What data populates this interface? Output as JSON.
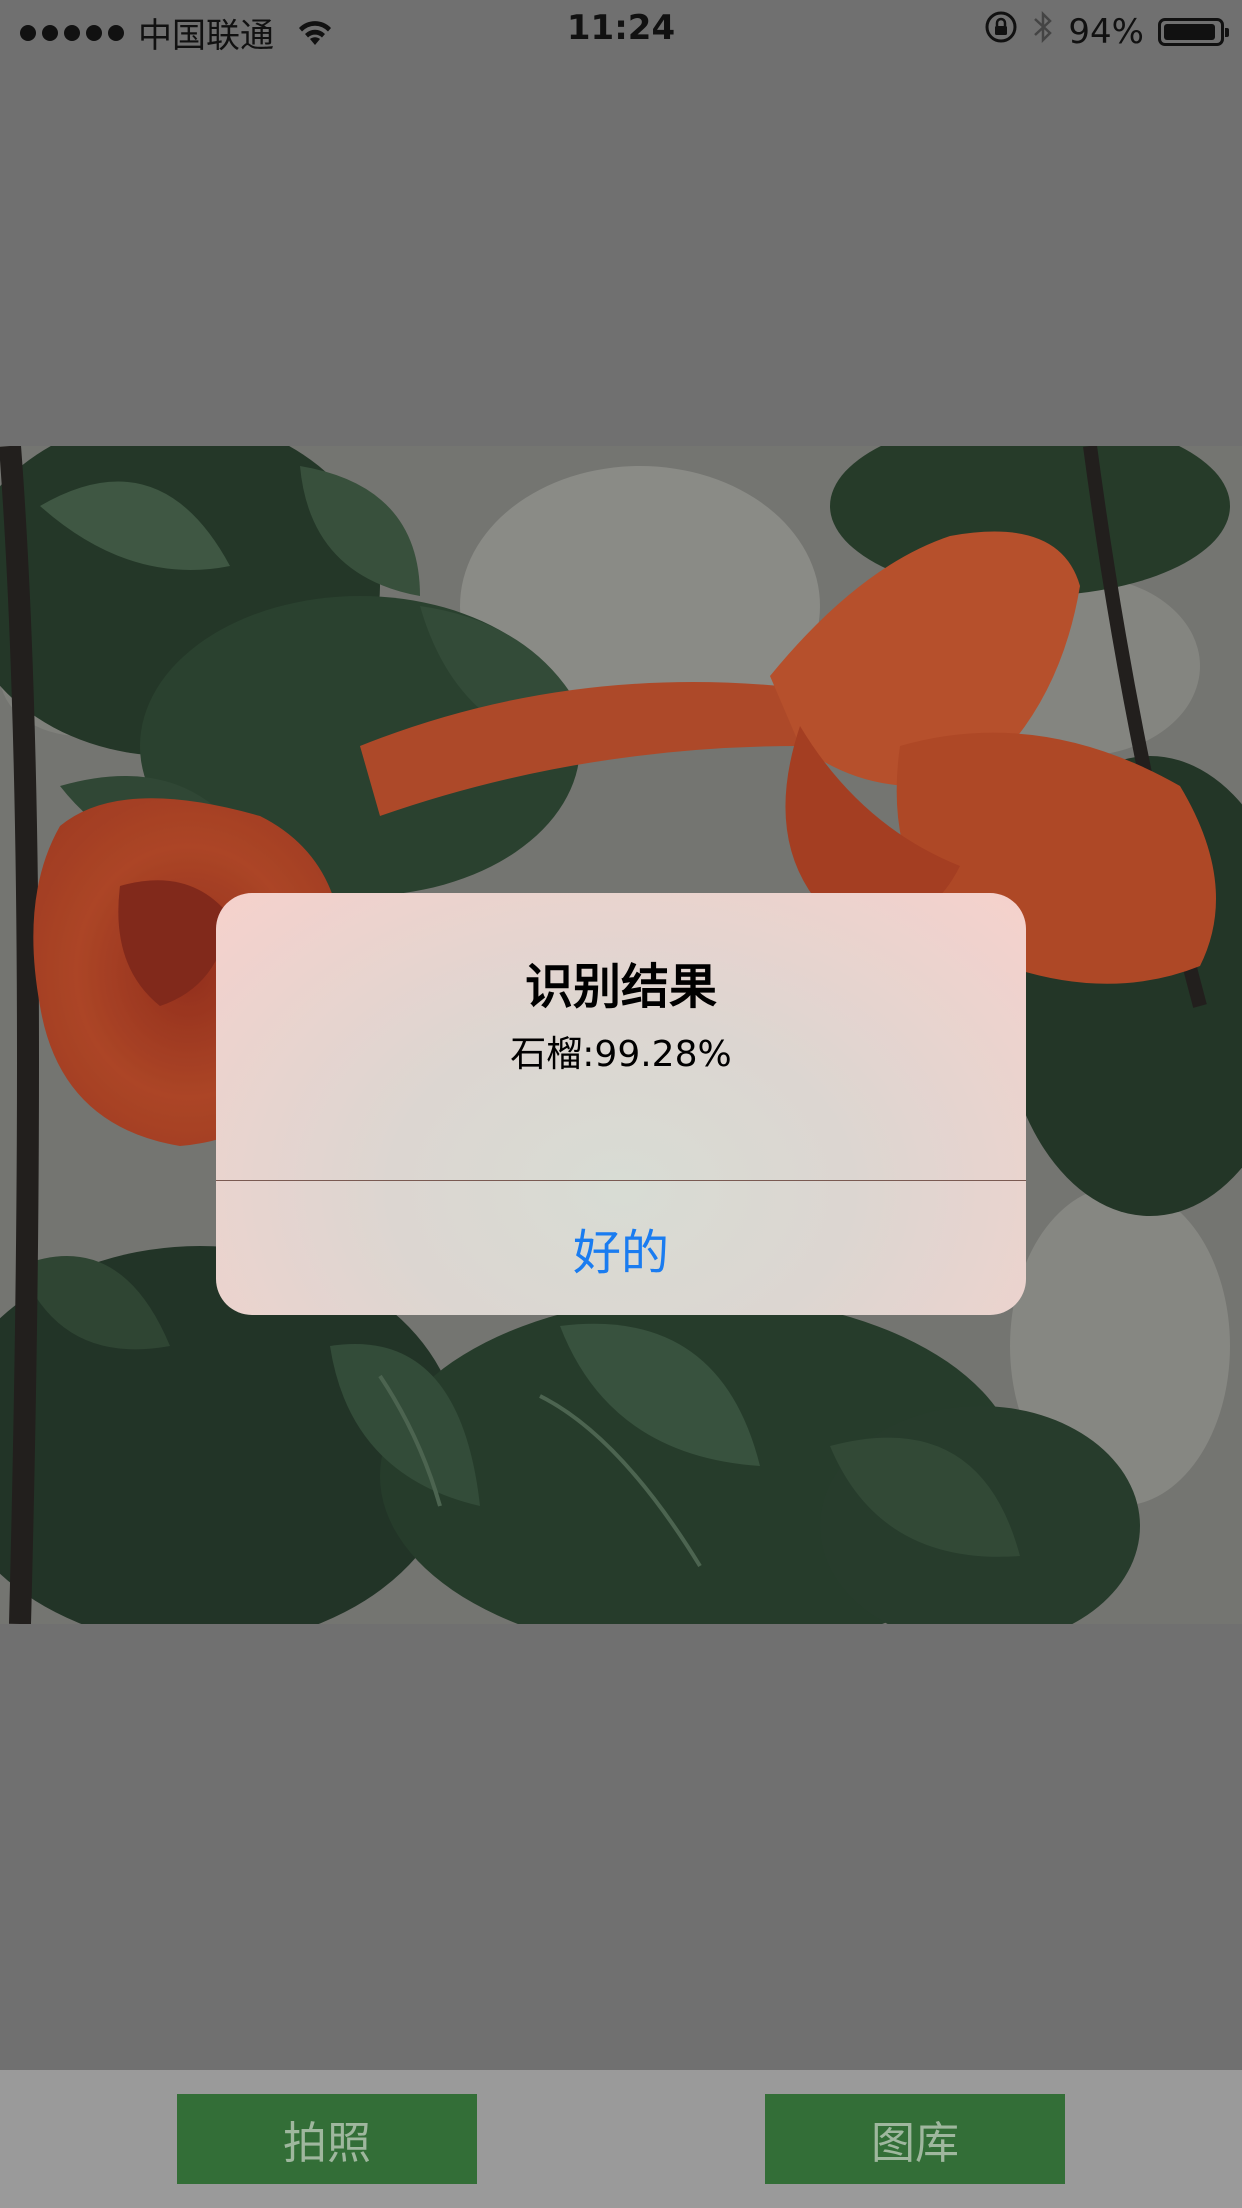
{
  "status_bar": {
    "carrier": "中国联通",
    "time": "11:24",
    "battery_percent": "94%",
    "battery_level": 0.94,
    "icons": [
      "signal-dots",
      "wifi-icon",
      "rotation-lock-icon",
      "bluetooth-icon",
      "battery-icon"
    ]
  },
  "photo": {
    "subject": "pomegranate-flower-photo",
    "colors": {
      "flower": "#d8532e",
      "leaves": "#2e4d34",
      "sky": "#b9bab4"
    }
  },
  "alert": {
    "title": "识别结果",
    "message": "石榴:99.28%",
    "ok_label": "好的",
    "button_color": "#1a7cf0"
  },
  "toolbar": {
    "camera_label": "拍照",
    "library_label": "图库",
    "button_color": "#336e37"
  }
}
